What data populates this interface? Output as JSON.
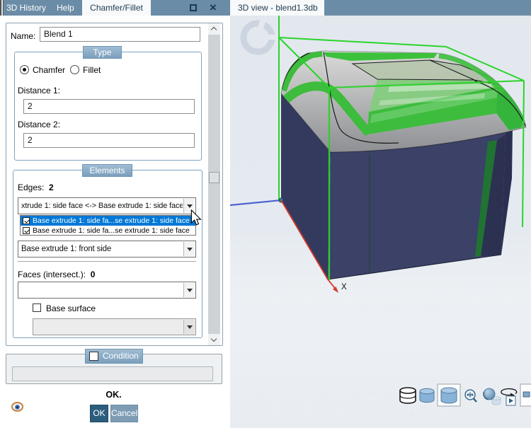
{
  "window": {
    "tabs_left": [
      "3D History",
      "Help",
      "Chamfer/Fillet"
    ],
    "active_left_tab": "Chamfer/Fillet",
    "right_tab": "3D view - blend1.3db",
    "maximize_icon": "maximize",
    "close_icon": "close"
  },
  "dialog": {
    "name_label": "Name:",
    "name_value": "Blend 1",
    "type_group": {
      "title": "Type",
      "radio_chamfer": "Chamfer",
      "radio_fillet": "Fillet",
      "selected": "Chamfer"
    },
    "distance1_label": "Distance 1:",
    "distance1_value": "2",
    "distance2_label": "Distance 2:",
    "distance2_value": "2",
    "elements_group": {
      "title": "Elements",
      "edges_label": "Edges:",
      "edges_count": "2",
      "edges_combo_value": "xtrude 1: side face <-> Base extrude 1: side face",
      "edges_dropdown": [
        {
          "label": "Base extrude 1: side fa...se extrude 1: side face",
          "checked": true,
          "highlighted": true
        },
        {
          "label": "Base extrude 1: side fa...se extrude 1: side face",
          "checked": true,
          "highlighted": false
        }
      ],
      "front_combo_value": "Base extrude 1: front side",
      "faces_label": "Faces (intersect.):",
      "faces_count": "0",
      "faces_combo_value": "",
      "base_surface_label": "Base surface",
      "base_surface_checked": false,
      "base_surface_combo_value": ""
    },
    "condition_group": {
      "title": "Condition",
      "checked": false,
      "field_value": ""
    },
    "status_text": "OK.",
    "ok_button": "OK",
    "cancel_button": "Cancel"
  },
  "viewport": {
    "x_axis_label": "X",
    "toolbar_icons": [
      "wireframe-cylinder",
      "shaded-cylinder",
      "shaded-cylinder-selected",
      "zoom-fit",
      "shaded-sphere",
      "rotate-animation",
      "display-options"
    ]
  },
  "colors": {
    "tab_bar": "#6b8ca6",
    "active_tab_bg": "#f7f9fa",
    "group_header": "#7b9fbd",
    "list_highlight": "#0078d7",
    "ok_button": "#2d5d7d",
    "cancel_button": "#7e9db5",
    "model_body": "#3a4066",
    "selection_green": "#2ecc2e"
  }
}
